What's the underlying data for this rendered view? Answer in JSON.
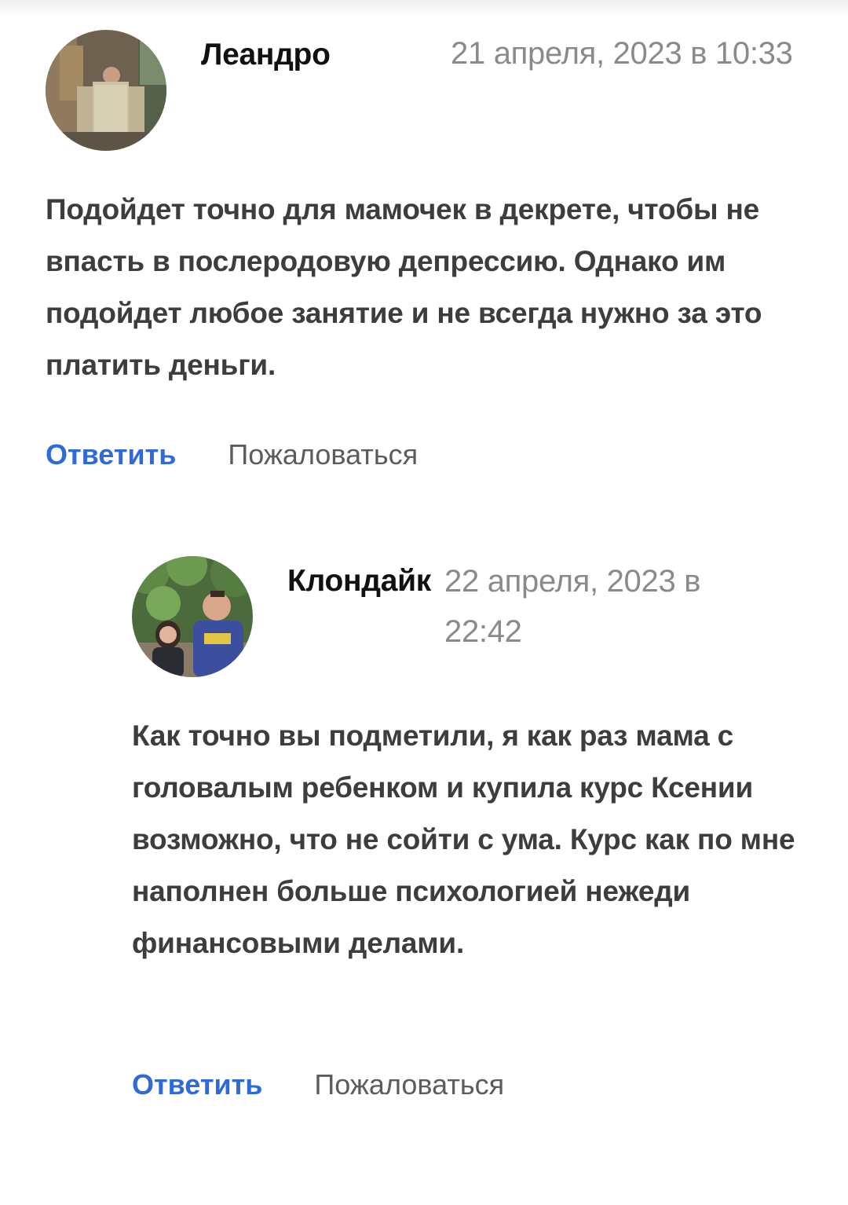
{
  "comments": [
    {
      "author": "Леандро",
      "date": "21 апреля, 2023 в 10:33",
      "text": "Подойдет точно для мамочек в декрете, чтобы не впасть в послеродовую депрессию. Однако им подойдет любое занятие и не всегда нужно за это платить деньги.",
      "reply_label": "Ответить",
      "report_label": "Пожаловаться"
    },
    {
      "author": "Клондайк",
      "date": "22 апреля, 2023 в 22:42",
      "text": "Как точно вы подметили, я как раз мама с головалым ребенком и купила курс Ксении возможно, что не сойти с ума. Курс как по мне наполнен больше психологией нежеди финансовыми делами.",
      "reply_label": "Ответить",
      "report_label": "Пожаловаться"
    }
  ],
  "colors": {
    "link_blue": "#2f6ad9",
    "text_gray": "#3d3d3d",
    "date_gray": "#8a8a8a"
  }
}
